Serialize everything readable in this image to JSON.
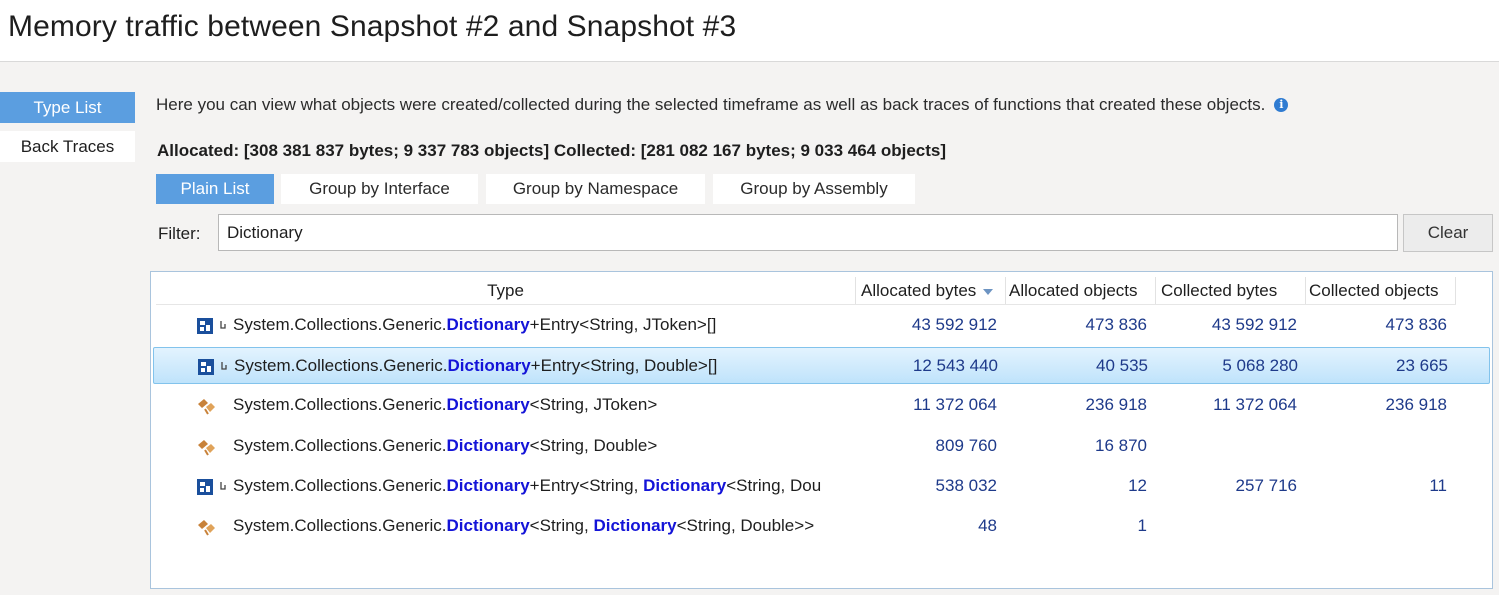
{
  "window": {
    "title": "Memory traffic between Snapshot #2 and Snapshot #3"
  },
  "sidebar": {
    "items": [
      {
        "label": "Type List",
        "active": true
      },
      {
        "label": "Back Traces",
        "active": false
      }
    ]
  },
  "description": "Here you can view what objects were created/collected during the selected timeframe as well as back traces of functions that created these objects.",
  "summary": "Allocated: [308 381 837 bytes; 9 337 783 objects] Collected: [281 082 167 bytes; 9 033 464 objects]",
  "view_tabs": [
    {
      "label": "Plain List",
      "active": true
    },
    {
      "label": "Group by Interface"
    },
    {
      "label": "Group by Namespace"
    },
    {
      "label": "Group by Assembly"
    }
  ],
  "filter": {
    "label": "Filter:",
    "value": "Dictionary",
    "clear_label": "Clear"
  },
  "columns": {
    "type": "Type",
    "alloc_bytes": "Allocated bytes",
    "alloc_objects": "Allocated objects",
    "coll_bytes": "Collected bytes",
    "coll_objects": "Collected objects"
  },
  "sort": {
    "column": "Allocated bytes",
    "direction": "descending"
  },
  "colors": {
    "accent": "#5b9ee0",
    "highlight": "#1414d8",
    "selected_row": "#bfe3fb"
  },
  "rows": [
    {
      "icon": "array-type-icon",
      "prefix": "System.Collections.Generic.",
      "match": "Dictionary",
      "rest": "+Entry<String, JToken>[]",
      "alloc_bytes": "43 592 912",
      "alloc_objects": "473 836",
      "coll_bytes": "43 592 912",
      "coll_objects": "473 836",
      "selected": false
    },
    {
      "icon": "array-type-icon",
      "prefix": "System.Collections.Generic.",
      "match": "Dictionary",
      "rest": "+Entry<String, Double>[]",
      "alloc_bytes": "12 543 440",
      "alloc_objects": "40 535",
      "coll_bytes": "5 068 280",
      "coll_objects": "23 665",
      "selected": true
    },
    {
      "icon": "class-type-icon",
      "prefix": "System.Collections.Generic.",
      "match": "Dictionary",
      "rest": "<String, JToken>",
      "alloc_bytes": "11 372 064",
      "alloc_objects": "236 918",
      "coll_bytes": "11 372 064",
      "coll_objects": "236 918",
      "selected": false
    },
    {
      "icon": "class-type-icon",
      "prefix": "System.Collections.Generic.",
      "match": "Dictionary",
      "rest": "<String, Double>",
      "alloc_bytes": "809 760",
      "alloc_objects": "16 870",
      "coll_bytes": "",
      "coll_objects": "",
      "selected": false
    },
    {
      "icon": "array-type-icon",
      "prefix": "System.Collections.Generic.",
      "match": "Dictionary",
      "rest": "+Entry<String, ",
      "match2": "Dictionary",
      "rest2": "<String, Dou",
      "alloc_bytes": "538 032",
      "alloc_objects": "12",
      "coll_bytes": "257 716",
      "coll_objects": "11",
      "selected": false
    },
    {
      "icon": "class-type-icon",
      "prefix": "System.Collections.Generic.",
      "match": "Dictionary",
      "rest": "<String, ",
      "match2": "Dictionary",
      "rest2": "<String, Double>>",
      "alloc_bytes": "48",
      "alloc_objects": "1",
      "coll_bytes": "",
      "coll_objects": "",
      "selected": false
    }
  ]
}
